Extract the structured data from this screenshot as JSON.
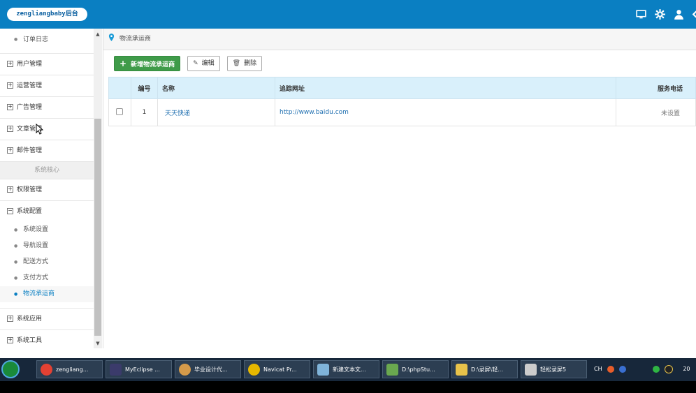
{
  "header": {
    "logo_text": "zengliangbaby后台"
  },
  "sidebar": {
    "top_sub": "订单日志",
    "groups_top": [
      "用户管理",
      "运营管理",
      "广告管理",
      "文章管理",
      "邮件管理"
    ],
    "category": "系统核心",
    "group_perm": "权限管理",
    "group_config": "系统配置",
    "config_items": [
      "系统设置",
      "导航设置",
      "配送方式",
      "支付方式",
      "物流承运商"
    ],
    "groups_bottom": [
      "系统应用",
      "系统工具"
    ]
  },
  "main": {
    "breadcrumb": "物流承运商",
    "buttons": {
      "add": "新增物流承运商",
      "edit": "编辑",
      "delete": "删除"
    },
    "table": {
      "headers": [
        "编号",
        "名称",
        "追踪网址",
        "服务电话"
      ],
      "rows": [
        {
          "id": "1",
          "name": "天天快递",
          "url": "http://www.baidu.com",
          "phone": "未设置"
        }
      ]
    }
  },
  "taskbar": {
    "items": [
      "zengliang...",
      "MyEclipse ...",
      "毕业设计代...",
      "Navicat Pr...",
      "新建文本文...",
      "D:\\phpStu...",
      "D:\\录屏\\轻...",
      "轻松录屏5"
    ],
    "tray_text": "CH",
    "clock": "20"
  }
}
